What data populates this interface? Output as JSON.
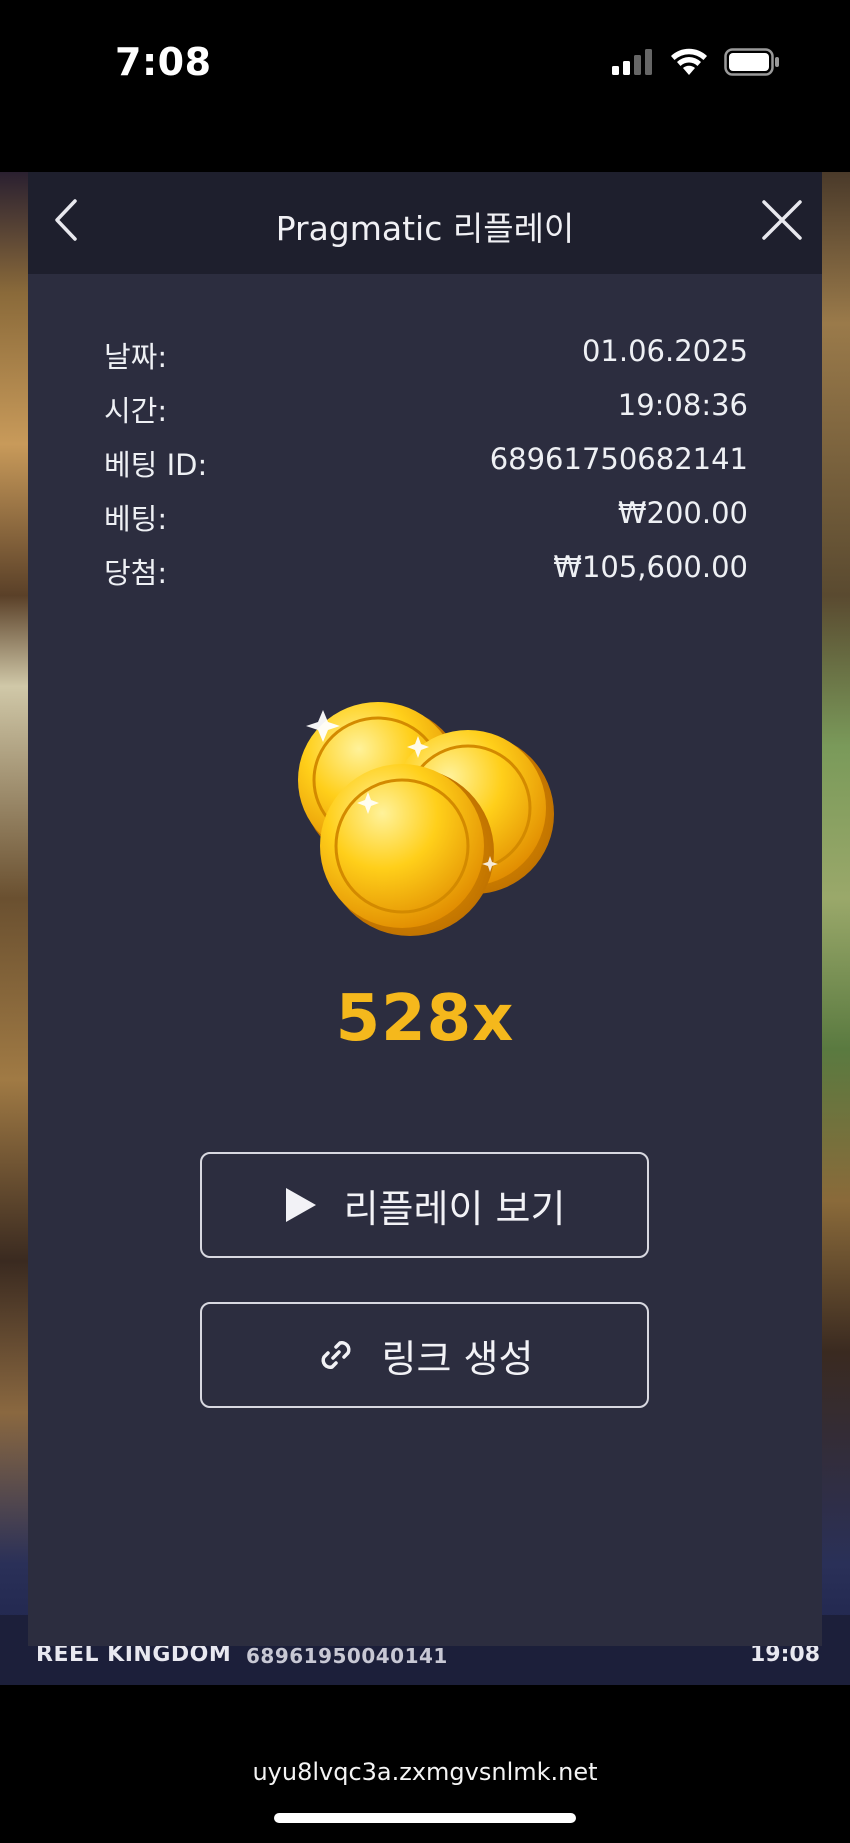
{
  "status_bar": {
    "time": "7:08",
    "icons": [
      "signal-icon",
      "wifi-icon",
      "battery-icon"
    ]
  },
  "header": {
    "title": "Pragmatic 리플레이"
  },
  "info_rows": [
    {
      "label": "날짜:",
      "value": "01.06.2025"
    },
    {
      "label": "시간:",
      "value": "19:08:36"
    },
    {
      "label": "베팅 ID:",
      "value": "68961750682141"
    },
    {
      "label": "베팅:",
      "value": "₩200.00"
    },
    {
      "label": "당첨:",
      "value": "₩105,600.00"
    }
  ],
  "win": {
    "multiplier": "528x",
    "icon": "gold-coins-icon"
  },
  "buttons": {
    "replay_label": "리플레이 보기",
    "link_label": "링크 생성"
  },
  "game_strip": {
    "brand": "REEL KINGDOM",
    "round_id": "68961950040141",
    "time": "19:08"
  },
  "browser": {
    "url": "uyu8lvqc3a.zxmgvsnlmk.net"
  },
  "colors": {
    "modal_bg": "#2c2d3f",
    "header_bg": "#1e1f2d",
    "multiplier": "#f5b81c"
  }
}
